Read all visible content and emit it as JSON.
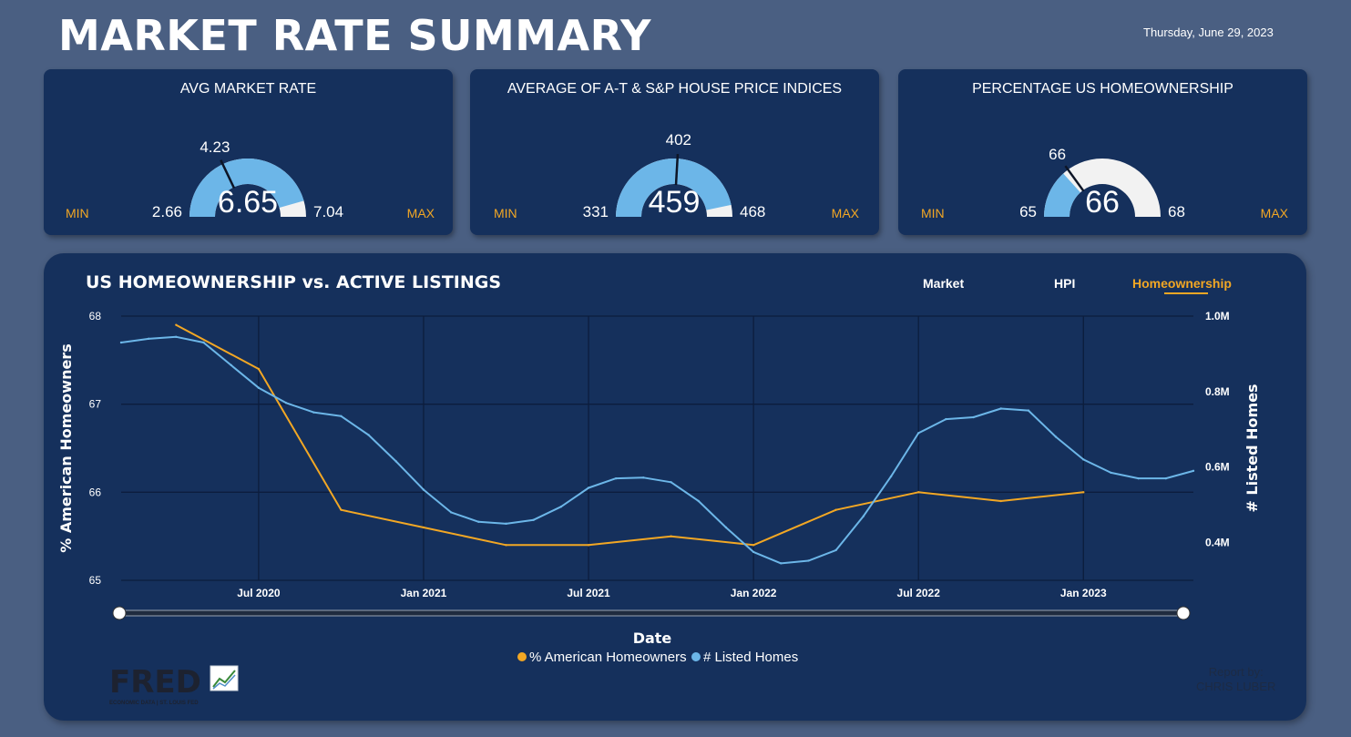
{
  "header": {
    "title": "MARKET RATE SUMMARY",
    "date": "Thursday, June 29, 2023"
  },
  "colors": {
    "background": "#4a5f82",
    "panel": "#15305c",
    "gauge_fill": "#6cb6e8",
    "gauge_track": "#f2f2f2",
    "accent": "#f2a724",
    "series_homeowners": "#f2a724",
    "series_listings": "#6cb6e8"
  },
  "gauges": [
    {
      "title": "AVG MARKET RATE",
      "min_word": "MIN",
      "max_word": "MAX",
      "min": 2.66,
      "max": 7.04,
      "value": 6.65,
      "target": 4.23,
      "min_text": "2.66",
      "max_text": "7.04",
      "value_text": "6.65",
      "target_text": "4.23"
    },
    {
      "title": "AVERAGE OF A-T & S&P HOUSE PRICE INDICES",
      "min_word": "MIN",
      "max_word": "MAX",
      "min": 331,
      "max": 468,
      "value": 459,
      "target": 402,
      "min_text": "331",
      "max_text": "468",
      "value_text": "459",
      "target_text": "402"
    },
    {
      "title": "PERCENTAGE US HOMEOWNERSHIP",
      "min_word": "MIN",
      "max_word": "MAX",
      "min": 65,
      "max": 68,
      "value": 65.8,
      "target": 65.9,
      "min_text": "65",
      "max_text": "68",
      "value_text": "66",
      "target_text": "66"
    }
  ],
  "main": {
    "title": "US HOMEOWNERSHIP vs. ACTIVE LISTINGS",
    "tabs": [
      {
        "label": "Market",
        "active": false
      },
      {
        "label": "HPI",
        "active": false
      },
      {
        "label": "Homeownership",
        "active": true
      }
    ],
    "report_by": "Report by:",
    "author": "CHRIS LUBER",
    "logo_text": "FRED",
    "logo_subtext": "ECONOMIC DATA  |  ST. LOUIS FED"
  },
  "chart_data": {
    "type": "line",
    "xlabel": "Date",
    "ylabel_left": "% American Homeowners",
    "ylabel_right": "# Listed Homes",
    "x_ticks": [
      "Jul 2020",
      "Jan 2021",
      "Jul 2021",
      "Jan 2022",
      "Jul 2022",
      "Jan 2023"
    ],
    "x_tick_dates": [
      "2020-07",
      "2021-01",
      "2021-07",
      "2022-01",
      "2022-07",
      "2023-01"
    ],
    "x_range": [
      "2020-02",
      "2023-05"
    ],
    "ylim_left": [
      65,
      68
    ],
    "y_ticks_left": [
      "65",
      "66",
      "67",
      "68"
    ],
    "ylim_right": [
      0.3,
      1.0
    ],
    "y_ticks_right": [
      {
        "value": 0.4,
        "label": "0.4M"
      },
      {
        "value": 0.6,
        "label": "0.6M"
      },
      {
        "value": 0.8,
        "label": "0.8M"
      },
      {
        "value": 1.0,
        "label": "1.0M"
      }
    ],
    "grid": true,
    "legend_position": "bottom",
    "series": [
      {
        "name": "% American Homeowners",
        "axis": "left",
        "points": [
          [
            "2020-04",
            67.9
          ],
          [
            "2020-07",
            67.4
          ],
          [
            "2020-10",
            65.8
          ],
          [
            "2021-01",
            65.6
          ],
          [
            "2021-04",
            65.4
          ],
          [
            "2021-07",
            65.4
          ],
          [
            "2021-10",
            65.5
          ],
          [
            "2022-01",
            65.4
          ],
          [
            "2022-04",
            65.8
          ],
          [
            "2022-07",
            66.0
          ],
          [
            "2022-10",
            65.9
          ],
          [
            "2023-01",
            66.0
          ]
        ]
      },
      {
        "name": "# Listed Homes",
        "axis": "right",
        "points": [
          [
            "2020-02",
            0.93
          ],
          [
            "2020-03",
            0.94
          ],
          [
            "2020-04",
            0.945
          ],
          [
            "2020-05",
            0.93
          ],
          [
            "2020-06",
            0.87
          ],
          [
            "2020-07",
            0.81
          ],
          [
            "2020-08",
            0.77
          ],
          [
            "2020-09",
            0.745
          ],
          [
            "2020-10",
            0.735
          ],
          [
            "2020-11",
            0.685
          ],
          [
            "2020-12",
            0.615
          ],
          [
            "2021-01",
            0.54
          ],
          [
            "2021-02",
            0.48
          ],
          [
            "2021-03",
            0.455
          ],
          [
            "2021-04",
            0.45
          ],
          [
            "2021-05",
            0.46
          ],
          [
            "2021-06",
            0.495
          ],
          [
            "2021-07",
            0.545
          ],
          [
            "2021-08",
            0.57
          ],
          [
            "2021-09",
            0.572
          ],
          [
            "2021-10",
            0.56
          ],
          [
            "2021-11",
            0.51
          ],
          [
            "2021-12",
            0.44
          ],
          [
            "2022-01",
            0.375
          ],
          [
            "2022-02",
            0.345
          ],
          [
            "2022-03",
            0.352
          ],
          [
            "2022-04",
            0.38
          ],
          [
            "2022-05",
            0.47
          ],
          [
            "2022-06",
            0.575
          ],
          [
            "2022-07",
            0.69
          ],
          [
            "2022-08",
            0.727
          ],
          [
            "2022-09",
            0.732
          ],
          [
            "2022-10",
            0.755
          ],
          [
            "2022-11",
            0.75
          ],
          [
            "2022-12",
            0.68
          ],
          [
            "2023-01",
            0.62
          ],
          [
            "2023-02",
            0.585
          ],
          [
            "2023-03",
            0.57
          ],
          [
            "2023-04",
            0.57
          ],
          [
            "2023-05",
            0.59
          ]
        ]
      }
    ]
  }
}
